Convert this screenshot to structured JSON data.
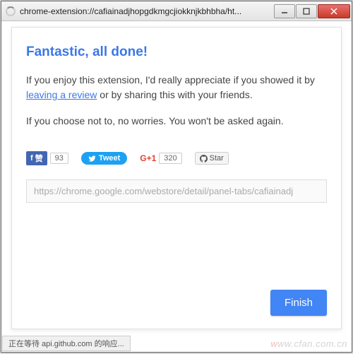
{
  "window": {
    "title": "chrome-extension://cafiainadjhopgdkmgcjiokknjkbhbha/ht..."
  },
  "content": {
    "heading": "Fantastic, all done!",
    "para1_a": "If you enjoy this extension, I'd really appreciate if you showed it by ",
    "para1_link": "leaving a review",
    "para1_b": " or by sharing this with your friends.",
    "para2": "If you choose not to, no worries. You won't be asked again."
  },
  "share": {
    "fb_label": "赞",
    "fb_count": "93",
    "tweet_label": "Tweet",
    "g1_label": "G+1",
    "g1_count": "320",
    "gh_label": "Star"
  },
  "url_value": "https://chrome.google.com/webstore/detail/panel-tabs/cafiainadj",
  "finish_label": "Finish",
  "status_text": "正在等待 api.github.com 的响应...",
  "watermark": "www.cfan.com.cn"
}
